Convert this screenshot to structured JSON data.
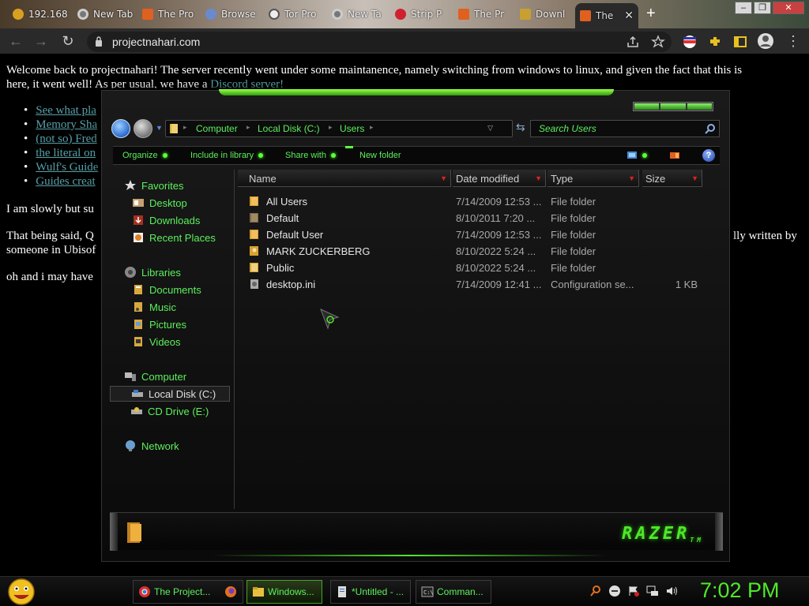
{
  "browser": {
    "tabs": [
      {
        "label": "192.168",
        "icon": "site-icon"
      },
      {
        "label": "New Tab",
        "icon": "chrome-icon"
      },
      {
        "label": "The Pro",
        "icon": "site-icon"
      },
      {
        "label": "Browse",
        "icon": "globe-icon"
      },
      {
        "label": "Tor Pro",
        "icon": "tor-icon"
      },
      {
        "label": "New Ta",
        "icon": "chrome-icon"
      },
      {
        "label": "Strip P",
        "icon": "heart-icon"
      },
      {
        "label": "The Pr",
        "icon": "site-icon"
      },
      {
        "label": "Downl",
        "icon": "download-icon"
      },
      {
        "label": "The",
        "icon": "site-icon",
        "active": true
      }
    ],
    "url": "projectnahari.com"
  },
  "webpage": {
    "intro": "Welcome back to projectnahari! The server recently went under some maintanence, namely switching from windows to linux, and given the fact that this is",
    "intro2": "here, it went well! As per usual, we have a",
    "discord_link": "Discord server!",
    "links": [
      "See what pla",
      "Memory Sha",
      "(not so) Fred",
      "the literal on",
      "Wulf's Guide",
      "Guides creat"
    ],
    "para2": "I am slowly but su",
    "para3a": "That being said, Q",
    "para3a_right": "lly written by",
    "para3b": "someone in Ubisof",
    "para4": "oh and i may have"
  },
  "explorer": {
    "breadcrumbs": [
      "Computer",
      "Local Disk (C:)",
      "Users"
    ],
    "search_placeholder": "Search Users",
    "commands": [
      "Organize",
      "Include in library",
      "Share with",
      "New folder"
    ],
    "nav": {
      "favorites": {
        "label": "Favorites",
        "items": [
          "Desktop",
          "Downloads",
          "Recent Places"
        ]
      },
      "libraries": {
        "label": "Libraries",
        "items": [
          "Documents",
          "Music",
          "Pictures",
          "Videos"
        ]
      },
      "computer": {
        "label": "Computer",
        "items": [
          "Local Disk (C:)",
          "CD Drive (E:)"
        ],
        "selected": "Local Disk (C:)"
      },
      "network": {
        "label": "Network"
      }
    },
    "columns": [
      "Name",
      "Date modified",
      "Type",
      "Size"
    ],
    "files": [
      {
        "name": "All Users",
        "date": "7/14/2009 12:53 ...",
        "type": "File folder",
        "size": ""
      },
      {
        "name": "Default",
        "date": "8/10/2011 7:20 ...",
        "type": "File folder",
        "size": ""
      },
      {
        "name": "Default User",
        "date": "7/14/2009 12:53 ...",
        "type": "File folder",
        "size": ""
      },
      {
        "name": "MARK ZUCKERBERG",
        "date": "8/10/2022 5:24 ...",
        "type": "File folder",
        "size": ""
      },
      {
        "name": "Public",
        "date": "8/10/2022 5:24 ...",
        "type": "File folder",
        "size": ""
      },
      {
        "name": "desktop.ini",
        "date": "7/14/2009 12:41 ...",
        "type": "Configuration se...",
        "size": "1 KB"
      }
    ],
    "brand": "RAZER",
    "brand_tm": "TM"
  },
  "taskbar": {
    "buttons": [
      {
        "label": "The Project...",
        "icon": "chrome-icon"
      },
      {
        "label": "",
        "icon": "firefox-icon"
      },
      {
        "label": "Windows...",
        "icon": "folder-icon",
        "active": true
      },
      {
        "label": "*Untitled - ...",
        "icon": "notepad-icon"
      },
      {
        "label": "Comman...",
        "icon": "cmd-icon"
      }
    ],
    "clock": "7:02 PM"
  },
  "colors": {
    "accent_green": "#5cf05c",
    "link": "#57a0a8",
    "close_red": "#e02020"
  }
}
